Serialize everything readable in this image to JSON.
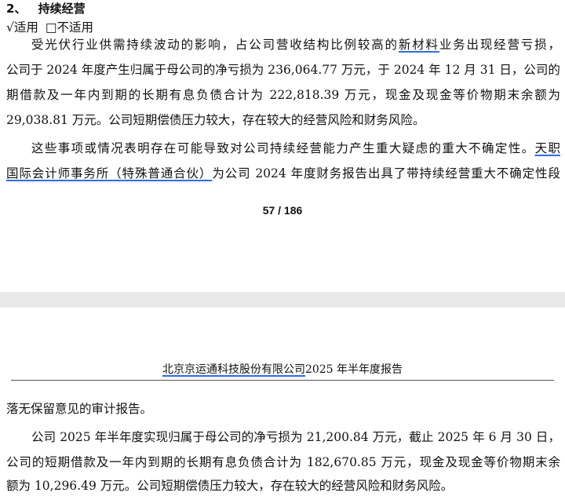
{
  "page1": {
    "heading_number": "2、",
    "heading_title": "持续经营",
    "check_applicable": "√适用",
    "check_not_applicable": "□不适用",
    "p1_l1_a": "受光伏行业供需持续波动的影响，占公司营收结构比例较高的",
    "p1_l1_link": "新材料",
    "p1_l1_b": "业务出现经营亏损，",
    "p1_l2": "公司于 2024 年度产生归属于母公司的净亏损为 236,064.77 万元，于 2024 年 12 月 31 日，公司的短",
    "p1_l3": "期借款及一年内到期的长期有息负债合计为 222,818.39 万元，现金及现金等价物期末余额为",
    "p1_l4": "29,038.81 万元。公司短期偿债压力较大，存在较大的经营风险和财务风险。",
    "p2_l1_a": "这些事项或情况表明存在可能导致对公司持续经营能力产生重大疑虑的重大不确定性。",
    "p2_l1_link": "天职",
    "p2_l2_link": "国际会计师事务所（特殊普通合伙）",
    "p2_l2_b": "为公司 2024 年度财务报告出具了带持续经营重大不确定性段",
    "page_number": "57 / 186"
  },
  "page2": {
    "header_company": "北京京运通科技股份有限公司",
    "header_report": "2025 年半年度报告",
    "l1": "落无保留意见的审计报告。",
    "l2": "公司 2025 年半年度实现归属于母公司的净亏损为 21,200.84 万元，截止 2025 年 6 月 30 日，",
    "l3": "公司的短期借款及一年内到期的长期有息负债合计为 182,670.85 万元，现金及现金等价物期末余",
    "l4": "额为 10,296.49 万元。公司短期偿债压力较大，存在较大的经营风险和财务风险。"
  },
  "colors": {
    "underline": "#2f6fd6",
    "separator": "#e9e9e9"
  }
}
